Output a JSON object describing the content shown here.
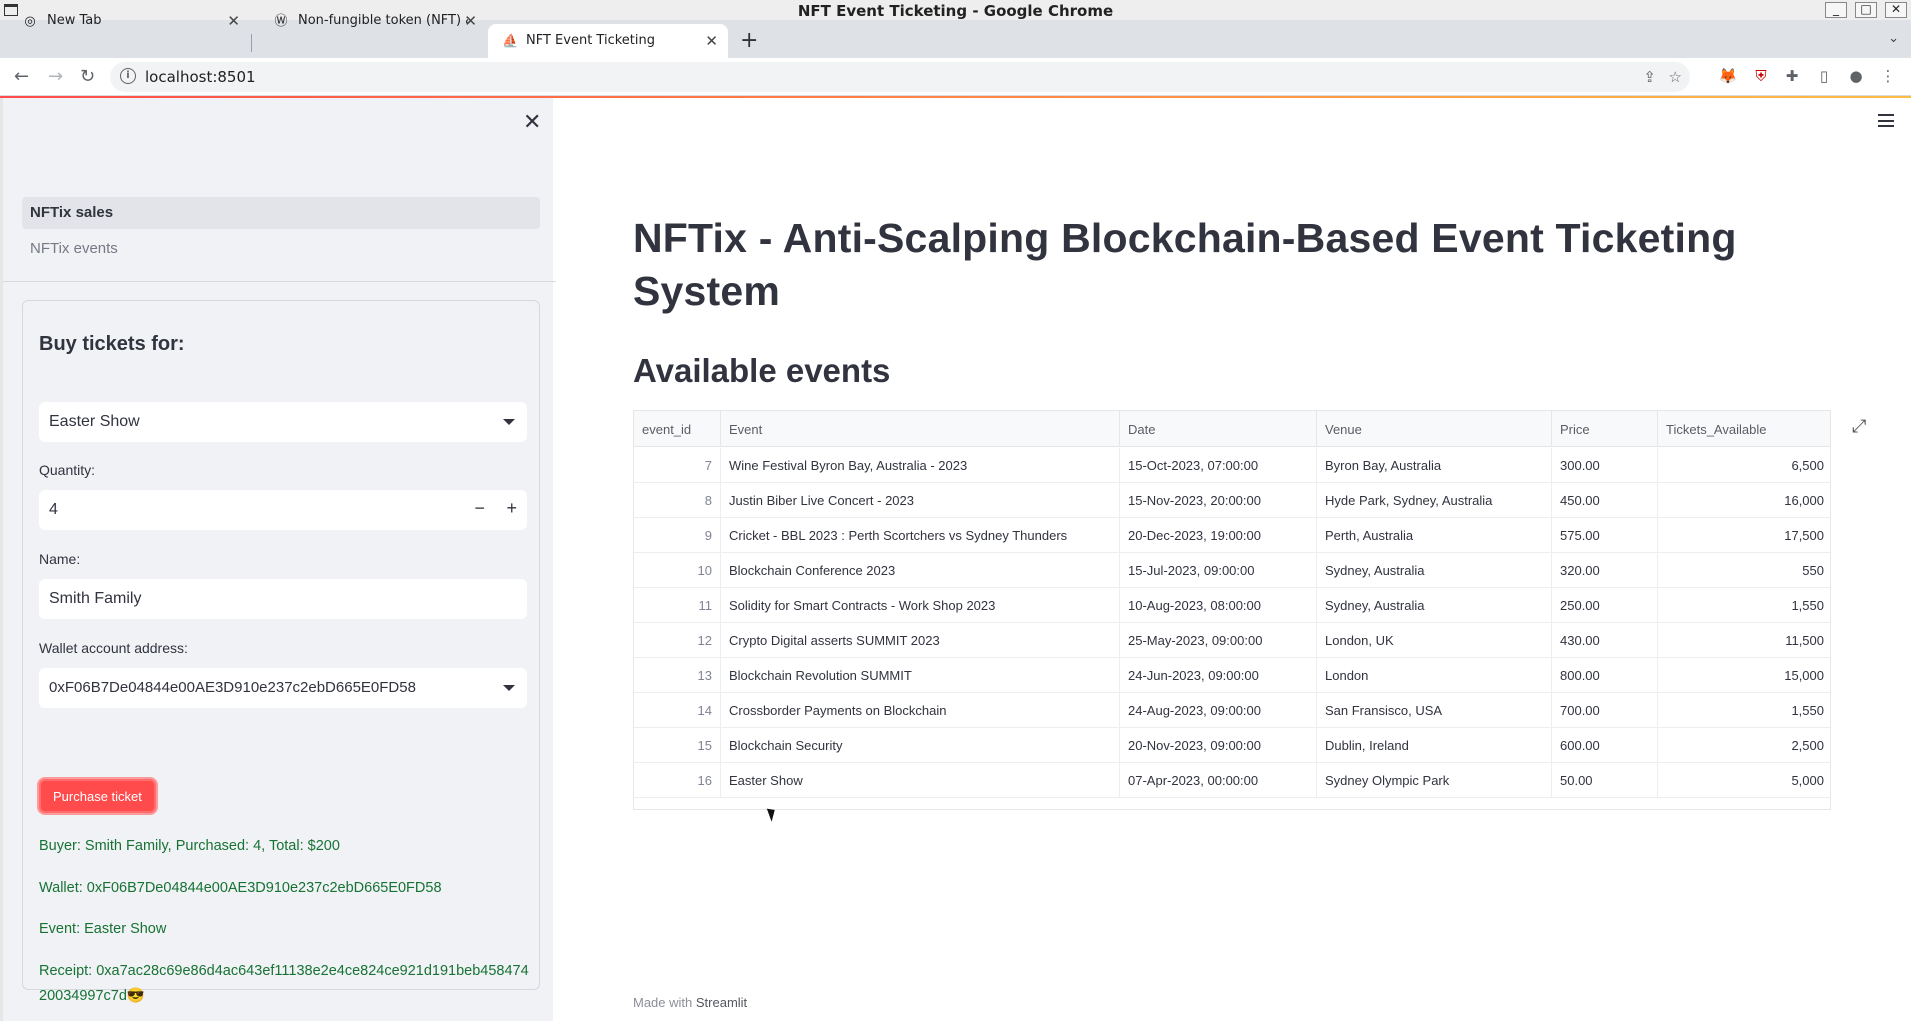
{
  "window": {
    "title": "NFT Event Ticketing - Google Chrome"
  },
  "tabs": [
    {
      "label": "New Tab",
      "icon": "chrome-icon"
    },
    {
      "label": "Non-fungible token (NFT) a",
      "icon": "wordpress-icon"
    },
    {
      "label": "NFT Event Ticketing",
      "icon": "streamlit-icon"
    }
  ],
  "address_bar": {
    "url": "localhost:8501"
  },
  "sidebar": {
    "nav": [
      {
        "label": "NFTix sales"
      },
      {
        "label": "NFTix events"
      }
    ],
    "form": {
      "title": "Buy tickets for:",
      "event_selected": "Easter Show",
      "quantity_label": "Quantity:",
      "quantity_value": "4",
      "name_label": "Name:",
      "name_value": "Smith Family",
      "wallet_label": "Wallet account address:",
      "wallet_value": "0xF06B7De04844e00AE3D910e237c2ebD665E0FD58",
      "purchase_button": "Purchase ticket",
      "result_buyer": "Buyer: Smith Family, Purchased: 4, Total: $200",
      "result_wallet": "Wallet: 0xF06B7De04844e00AE3D910e237c2ebD665E0FD58",
      "result_event": "Event: Easter Show",
      "result_receipt": "Receipt: 0xa7ac28c69e86d4ac643ef11138e2e4ce824ce921d191beb45847420034997c7d😎"
    }
  },
  "main": {
    "title": "NFTix - Anti-Scalping Blockchain-Based Event Ticketing System",
    "subtitle": "Available events",
    "table": {
      "columns": [
        "event_id",
        "Event",
        "Date",
        "Venue",
        "Price",
        "Tickets_Available"
      ],
      "rows": [
        [
          "7",
          "Wine Festival Byron Bay, Australia - 2023",
          "15-Oct-2023, 07:00:00",
          "Byron Bay, Australia",
          "300.00",
          "6,500"
        ],
        [
          "8",
          "Justin Biber Live Concert - 2023",
          "15-Nov-2023, 20:00:00",
          "Hyde Park, Sydney, Australia",
          "450.00",
          "16,000"
        ],
        [
          "9",
          "Cricket - BBL 2023 : Perth Scortchers vs Sydney Thunders",
          "20-Dec-2023, 19:00:00",
          "Perth, Australia",
          "575.00",
          "17,500"
        ],
        [
          "10",
          "Blockchain Conference 2023",
          "15-Jul-2023, 09:00:00",
          "Sydney, Australia",
          "320.00",
          "550"
        ],
        [
          "11",
          "Solidity for Smart Contracts - Work Shop 2023",
          "10-Aug-2023, 08:00:00",
          "Sydney, Australia",
          "250.00",
          "1,550"
        ],
        [
          "12",
          "Crypto Digital asserts SUMMIT 2023",
          "25-May-2023, 09:00:00",
          "London, UK",
          "430.00",
          "11,500"
        ],
        [
          "13",
          "Blockchain Revolution SUMMIT",
          "24-Jun-2023, 09:00:00",
          "London",
          "800.00",
          "15,000"
        ],
        [
          "14",
          "Crossborder Payments on Blockchain",
          "24-Aug-2023, 09:00:00",
          "San Fransisco, USA",
          "700.00",
          "1,550"
        ],
        [
          "15",
          "Blockchain Security",
          "20-Nov-2023, 09:00:00",
          "Dublin, Ireland",
          "600.00",
          "2,500"
        ],
        [
          "16",
          "Easter Show",
          "07-Apr-2023, 00:00:00",
          "Sydney Olympic Park",
          "50.00",
          "5,000"
        ]
      ]
    },
    "footer_prefix": "Made with",
    "footer_brand": "Streamlit"
  },
  "colors": {
    "accent": "#ff4b4b",
    "success_text": "#177233",
    "sidebar_bg": "#f0f2f6"
  }
}
